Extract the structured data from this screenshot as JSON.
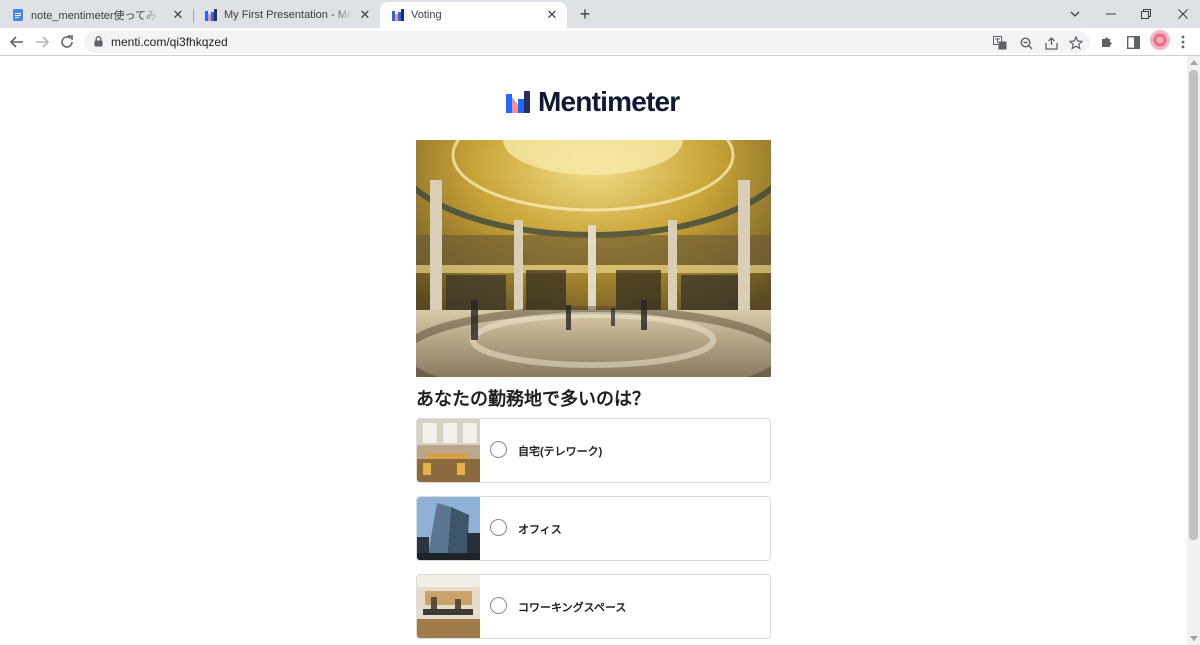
{
  "browser": {
    "tabs": [
      {
        "title": "note_mentimeter使ってみた - Goo",
        "icon": "google-docs-icon",
        "active": false
      },
      {
        "title": "My First Presentation - Mentimet",
        "icon": "mentimeter-icon",
        "active": false
      },
      {
        "title": "Voting",
        "icon": "mentimeter-icon",
        "active": true
      }
    ],
    "url": "menti.com/qi3fhkqzed"
  },
  "page": {
    "logo_text": "Mentimeter",
    "question": "あなたの勤務地で多いのは？",
    "options": [
      {
        "label": "自宅(テレワーク)",
        "thumb": "home-office-photo"
      },
      {
        "label": "オフィス",
        "thumb": "office-building-photo"
      },
      {
        "label": "コワーキングスペース",
        "thumb": "coworking-photo"
      }
    ]
  },
  "colors": {
    "brand_text": "#101834",
    "tabstrip": "#dee1e6",
    "logo_blue": "#196cff",
    "logo_pink": "#ff8b8b"
  }
}
